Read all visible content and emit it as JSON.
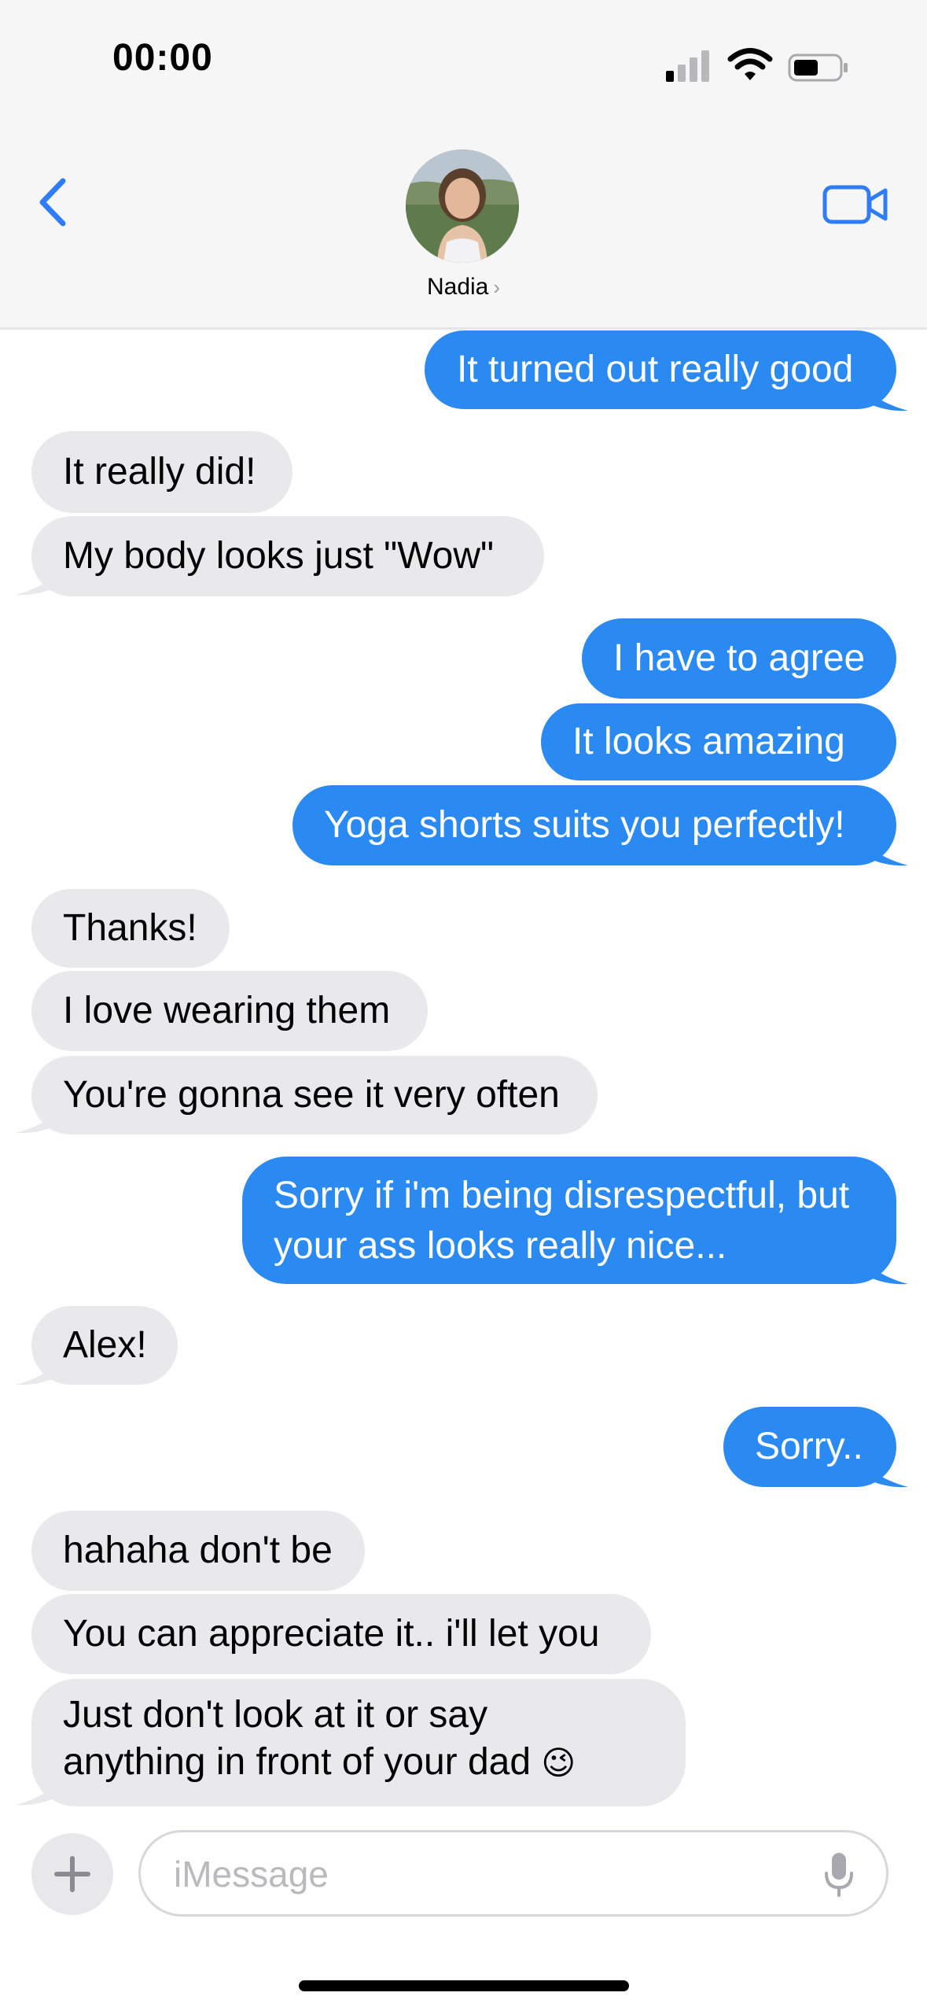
{
  "status_bar": {
    "time": "00:00"
  },
  "header": {
    "contact_name": "Nadia",
    "contact_chevron": "›"
  },
  "messages": [
    {
      "side": "out",
      "text": "It turned out really good"
    },
    {
      "side": "in",
      "text": "It really did!"
    },
    {
      "side": "in",
      "text": "My body looks just \"Wow\""
    },
    {
      "side": "out",
      "text": "I have to agree"
    },
    {
      "side": "out",
      "text": "It looks amazing "
    },
    {
      "side": "out",
      "text": "Yoga shorts suits you perfectly!"
    },
    {
      "side": "in",
      "text": "Thanks!"
    },
    {
      "side": "in",
      "text": "I love wearing them"
    },
    {
      "side": "in",
      "text": "You're gonna see it very often"
    },
    {
      "side": "out",
      "line1": "Sorry if i'm being disrespectful, but",
      "line2": "your ass looks really nice..."
    },
    {
      "side": "in",
      "text": "Alex!"
    },
    {
      "side": "out",
      "text": "Sorry.."
    },
    {
      "side": "in",
      "text": "hahaha don't be"
    },
    {
      "side": "in",
      "text": "You can appreciate it.. i'll let you"
    },
    {
      "side": "in",
      "line1": "Just don't look at it or say",
      "line2": "anything in front of your dad",
      "emoji": "😉"
    }
  ],
  "composer": {
    "placeholder": "iMessage"
  },
  "colors": {
    "outgoing": "#2a8af2",
    "incoming": "#e9e9eb",
    "accent": "#2f7cf6"
  },
  "icons": [
    "back-chevron-icon",
    "video-camera-icon",
    "signal-icon",
    "wifi-icon",
    "battery-icon",
    "plus-icon",
    "microphone-icon"
  ]
}
